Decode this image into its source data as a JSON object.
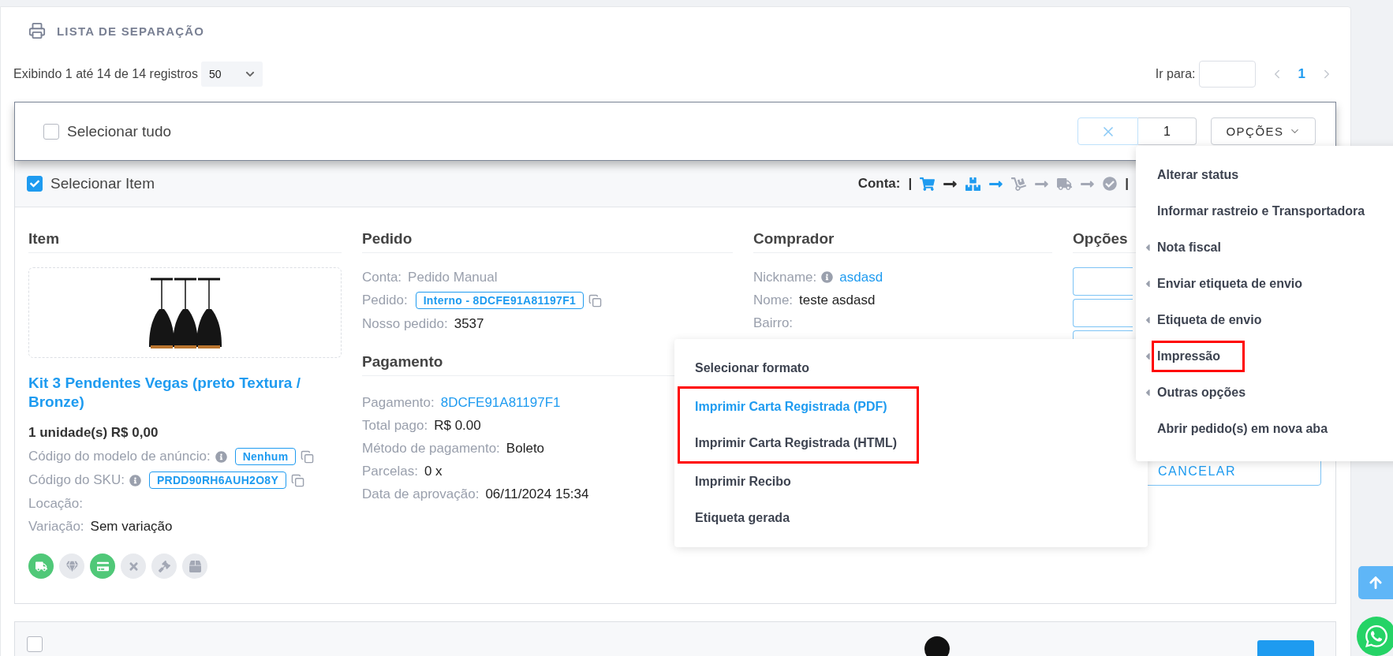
{
  "header": {
    "title": "LISTA DE SEPARAÇÃO"
  },
  "listing": {
    "info": "Exibindo 1 até 14 de 14 registros",
    "page_size": "50",
    "goto_label": "Ir para:",
    "pages": [
      {
        "label": "1",
        "selected": true
      }
    ]
  },
  "select_bar": {
    "select_all": {
      "label": "Selecionar tudo",
      "checked": false
    },
    "count": "1",
    "options_button": "OPÇÕES"
  },
  "card": {
    "select": {
      "label": "Selecionar Item",
      "checked": true
    },
    "account_label": "Conta:",
    "flow_open": "|",
    "flow_close": "|",
    "flow": [
      {
        "kind": "cart",
        "color": "#1e9bf0"
      },
      {
        "kind": "arrow",
        "color": "#333333"
      },
      {
        "kind": "boxes",
        "color": "#1e9bf0"
      },
      {
        "kind": "arrow",
        "color": "#1e9bf0"
      },
      {
        "kind": "dolly",
        "color": "#a3a8b5"
      },
      {
        "kind": "arrow",
        "color": "#a3a8b5"
      },
      {
        "kind": "truck",
        "color": "#a3a8b5"
      },
      {
        "kind": "arrow",
        "color": "#a3a8b5"
      },
      {
        "kind": "check",
        "color": "#a3a8b5"
      }
    ],
    "item": {
      "heading": "Item",
      "title": "Kit 3 Pendentes Vegas (preto Textura / Bronze)",
      "quantity": "1 unidade(s) R$ 0,00",
      "fields": [
        {
          "label": "Código do modelo de anúncio:",
          "info": true,
          "kind": "chip",
          "value": "Nenhum"
        },
        {
          "label": "Código do SKU:",
          "info": true,
          "kind": "chip",
          "value": "PRDD90RH6AUH2O8Y"
        },
        {
          "label": "Locação:",
          "info": false,
          "kind": "text"
        },
        {
          "label": "Variação:",
          "info": false,
          "kind": "text",
          "value": "Sem variação"
        }
      ],
      "status_icons": [
        {
          "kind": "truck",
          "active": true
        },
        {
          "kind": "gem",
          "active": false
        },
        {
          "kind": "card",
          "active": true
        },
        {
          "kind": "cross",
          "active": false
        },
        {
          "kind": "gavel",
          "active": false
        },
        {
          "kind": "box",
          "active": false
        }
      ]
    },
    "order": {
      "heading": "Pedido",
      "fields": [
        {
          "label": "Conta:",
          "info": false,
          "kind": "text",
          "value": "Pedido Manual",
          "muted": true
        },
        {
          "label": "Pedido:",
          "info": false,
          "kind": "chip",
          "value": "Interno - 8DCFE91A81197F1"
        },
        {
          "label": "Nosso pedido:",
          "info": false,
          "kind": "text",
          "value": "3537"
        }
      ]
    },
    "payment": {
      "heading": "Pagamento",
      "fields": [
        {
          "label": "Pagamento:",
          "info": false,
          "kind": "link",
          "value": "8DCFE91A81197F1"
        },
        {
          "label": "Total pago:",
          "info": false,
          "kind": "text",
          "value": "R$ 0.00"
        },
        {
          "label": "Método de pagamento:",
          "info": false,
          "kind": "text",
          "value": "Boleto"
        },
        {
          "label": "Parcelas:",
          "info": false,
          "kind": "text",
          "value": "0 x"
        },
        {
          "label": "Data de aprovação:",
          "info": false,
          "kind": "text",
          "value": "06/11/2024 15:34"
        }
      ]
    },
    "buyer": {
      "heading": "Comprador",
      "fields": [
        {
          "label": "Nickname:",
          "info": true,
          "kind": "link",
          "value": "asdasd"
        },
        {
          "label": "Nome:",
          "info": false,
          "kind": "text",
          "value": "teste asdasd"
        },
        {
          "label": "Bairro:",
          "info": false,
          "kind": "text"
        }
      ]
    },
    "options": {
      "heading": "Opções",
      "cancel_button": "CANCELAR"
    }
  },
  "options_menu": [
    {
      "label": "Alterar status",
      "submenu": false,
      "annotated": false
    },
    {
      "label": "Informar rastreio e Transportadora",
      "submenu": false,
      "annotated": false
    },
    {
      "label": "Nota fiscal",
      "submenu": true,
      "annotated": false
    },
    {
      "label": "Enviar etiqueta de envio",
      "submenu": true,
      "annotated": false
    },
    {
      "label": "Etiqueta de envio",
      "submenu": true,
      "annotated": false
    },
    {
      "label": "Impressão",
      "submenu": true,
      "annotated": true
    },
    {
      "label": "Outras opções",
      "submenu": true,
      "annotated": false
    },
    {
      "label": "Abrir pedido(s) em nova aba",
      "submenu": false,
      "annotated": false
    }
  ],
  "print_submenu": [
    {
      "label": "Selecionar formato",
      "selected": false,
      "annotated": false
    },
    {
      "label": "Imprimir Carta Registrada (PDF)",
      "selected": true,
      "annotated": true
    },
    {
      "label": "Imprimir Carta Registrada (HTML)",
      "selected": false,
      "annotated": true
    },
    {
      "label": "Imprimir Recibo",
      "selected": false,
      "annotated": false
    },
    {
      "label": "Etiqueta gerada",
      "selected": false,
      "annotated": false
    }
  ],
  "next_card": {
    "select": {
      "checked": false
    }
  }
}
